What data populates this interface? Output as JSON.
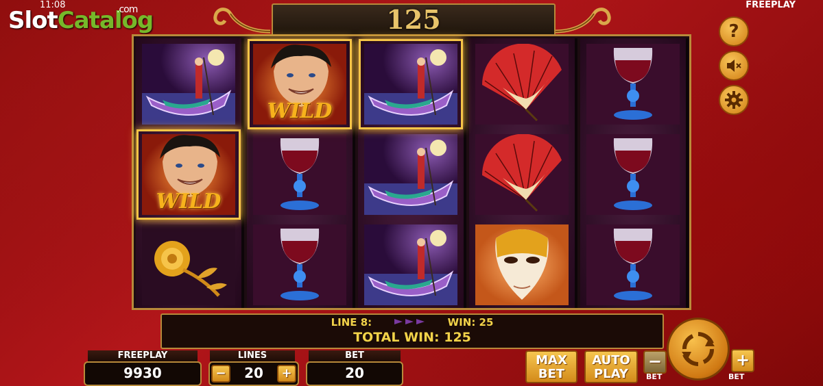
{
  "status_bar": {
    "time": "11:08",
    "mode": "FREEPLAY"
  },
  "watermark": {
    "part1": "Slot",
    "part2": "Catalog",
    "suffix": ".com"
  },
  "win_display": "125",
  "reels": [
    [
      "gondola",
      "wild",
      "rose"
    ],
    [
      "wild",
      "wine-glass",
      "wine-glass"
    ],
    [
      "gondola",
      "gondola",
      "gondola"
    ],
    [
      "fan",
      "fan",
      "mask"
    ],
    [
      "wine-glass",
      "wine-glass",
      "wine-glass"
    ]
  ],
  "wild_label": "WILD",
  "info": {
    "line_label": "LINE 8:",
    "win_label": "WIN: 25",
    "total_label": "TOTAL WIN: 125"
  },
  "bottom": {
    "balance_label": "FREEPLAY",
    "balance_value": "9930",
    "lines_label": "LINES",
    "lines_value": "20",
    "bet_label": "BET",
    "bet_value": "20",
    "minus": "−",
    "plus": "+",
    "max_bet": [
      "MAX",
      "BET"
    ],
    "auto_play": [
      "AUTO",
      "PLAY"
    ],
    "bet_minus_label": "BET",
    "bet_plus_label": "BET"
  },
  "side_buttons": {
    "help": "?"
  }
}
